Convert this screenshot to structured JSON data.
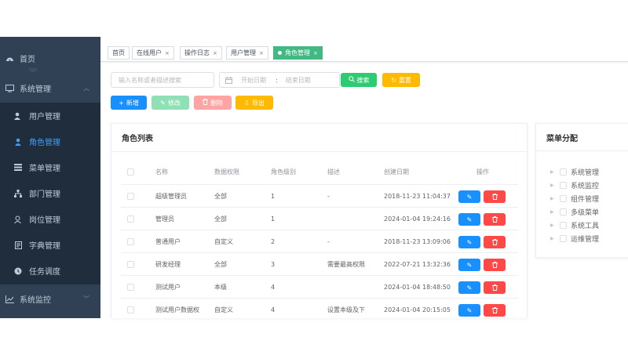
{
  "sidebar": {
    "home": {
      "label": "首页",
      "icon": "dashboard-icon"
    },
    "system": {
      "label": "系统管理",
      "icon": "monitor-icon"
    },
    "system_children": [
      {
        "label": "用户管理",
        "icon": "user-icon"
      },
      {
        "label": "角色管理",
        "icon": "peoples-icon",
        "active": true
      },
      {
        "label": "菜单管理",
        "icon": "menu-list-icon"
      },
      {
        "label": "部门管理",
        "icon": "tree-icon"
      },
      {
        "label": "岗位管理",
        "icon": "post-icon"
      },
      {
        "label": "字典管理",
        "icon": "dict-icon"
      },
      {
        "label": "任务调度",
        "icon": "job-icon"
      }
    ],
    "monitor": {
      "label": "系统监控",
      "icon": "chart-icon"
    }
  },
  "tags": [
    {
      "label": "首页",
      "closable": false
    },
    {
      "label": "在线用户",
      "closable": true
    },
    {
      "label": "操作日志",
      "closable": true
    },
    {
      "label": "用户管理",
      "closable": true
    },
    {
      "label": "角色管理",
      "closable": true,
      "active": true
    }
  ],
  "search": {
    "keyword_placeholder": "输入名称或者描述搜索",
    "start_placeholder": "开始日期",
    "separator": ":",
    "end_placeholder": "结束日期",
    "search_label": "搜索",
    "reset_label": "重置"
  },
  "toolbar": {
    "add_label": "新增",
    "edit_label": "修改",
    "delete_label": "删除",
    "export_label": "导出"
  },
  "role_table": {
    "title": "角色列表",
    "columns": [
      "名称",
      "数据权限",
      "角色级别",
      "描述",
      "创建日期",
      "操作"
    ],
    "rows": [
      {
        "name": "超级管理员",
        "scope": "全部",
        "level": "1",
        "desc": "-",
        "created": "2018-11-23 11:04:37"
      },
      {
        "name": "管理员",
        "scope": "全部",
        "level": "1",
        "desc": "",
        "created": "2024-01-04 19:24:16"
      },
      {
        "name": "普通用户",
        "scope": "自定义",
        "level": "2",
        "desc": "-",
        "created": "2018-11-23 13:09:06"
      },
      {
        "name": "研发经理",
        "scope": "全部",
        "level": "3",
        "desc": "需要最高权限",
        "created": "2022-07-21 13:32:36"
      },
      {
        "name": "测试用户",
        "scope": "本级",
        "level": "4",
        "desc": "",
        "created": "2024-01-04 18:48:50"
      },
      {
        "name": "测试用户数据权",
        "scope": "自定义",
        "level": "4",
        "desc": "设置本级及下",
        "created": "2024-01-04 20:15:05"
      }
    ]
  },
  "menu_panel": {
    "title": "菜单分配",
    "items": [
      "系统管理",
      "系统监控",
      "组件管理",
      "多级菜单",
      "系统工具",
      "运维管理"
    ]
  },
  "colors": {
    "sidebar_bg": "#304156",
    "submenu_bg": "#1f2d3d",
    "active_menu": "#409eff",
    "active_tag": "#42b983",
    "primary": "#1890ff",
    "success": "#2ecc71",
    "warning": "#ffba00",
    "danger": "#ff4949"
  }
}
